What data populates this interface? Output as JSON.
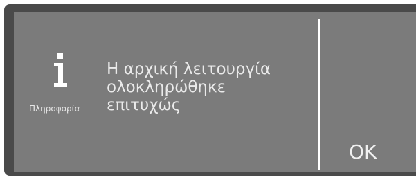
{
  "dialog": {
    "icon": "info-icon",
    "icon_caption": "Πληροφορία",
    "message_lines": [
      "Η αρχική λειτουργία",
      "ολοκληρώθηκε",
      "επιτυχώς"
    ]
  },
  "actions": {
    "ok_label": "OK"
  },
  "colors": {
    "frame": "#4a4a4a",
    "screen": "#7b7b7b",
    "text": "#eaeaea",
    "separator": "#ffffff"
  }
}
